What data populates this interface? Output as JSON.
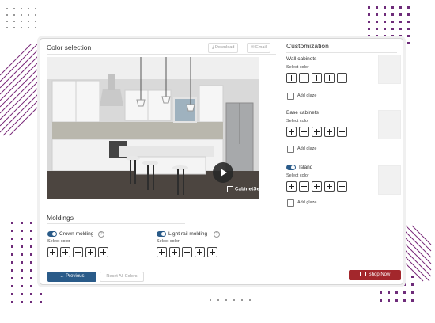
{
  "color_selection": {
    "title": "Color selection",
    "download_label": "⤓ Download",
    "email_label": "✉ Email",
    "watermark": "CabinetSet"
  },
  "customization": {
    "title": "Customization",
    "wall": {
      "title": "Wall cabinets",
      "select": "Select color",
      "glaze": "Add glaze"
    },
    "base": {
      "title": "Base cabinets",
      "select": "Select color",
      "glaze": "Add glaze"
    },
    "island": {
      "title": "Island",
      "select": "Select color",
      "glaze": "Add glaze"
    }
  },
  "moldings": {
    "title": "Moldings",
    "crown": {
      "label": "Crown molding",
      "select": "Select color"
    },
    "light": {
      "label": "Light rail molding",
      "select": "Select color"
    }
  },
  "footer": {
    "previous": "← Previous",
    "reset": "Reset All Colors",
    "shop": "Shop Now"
  },
  "colors": {
    "accent_blue": "#2a5b89",
    "shop_red": "#a3272c",
    "decor_purple": "#7a2a7a"
  }
}
